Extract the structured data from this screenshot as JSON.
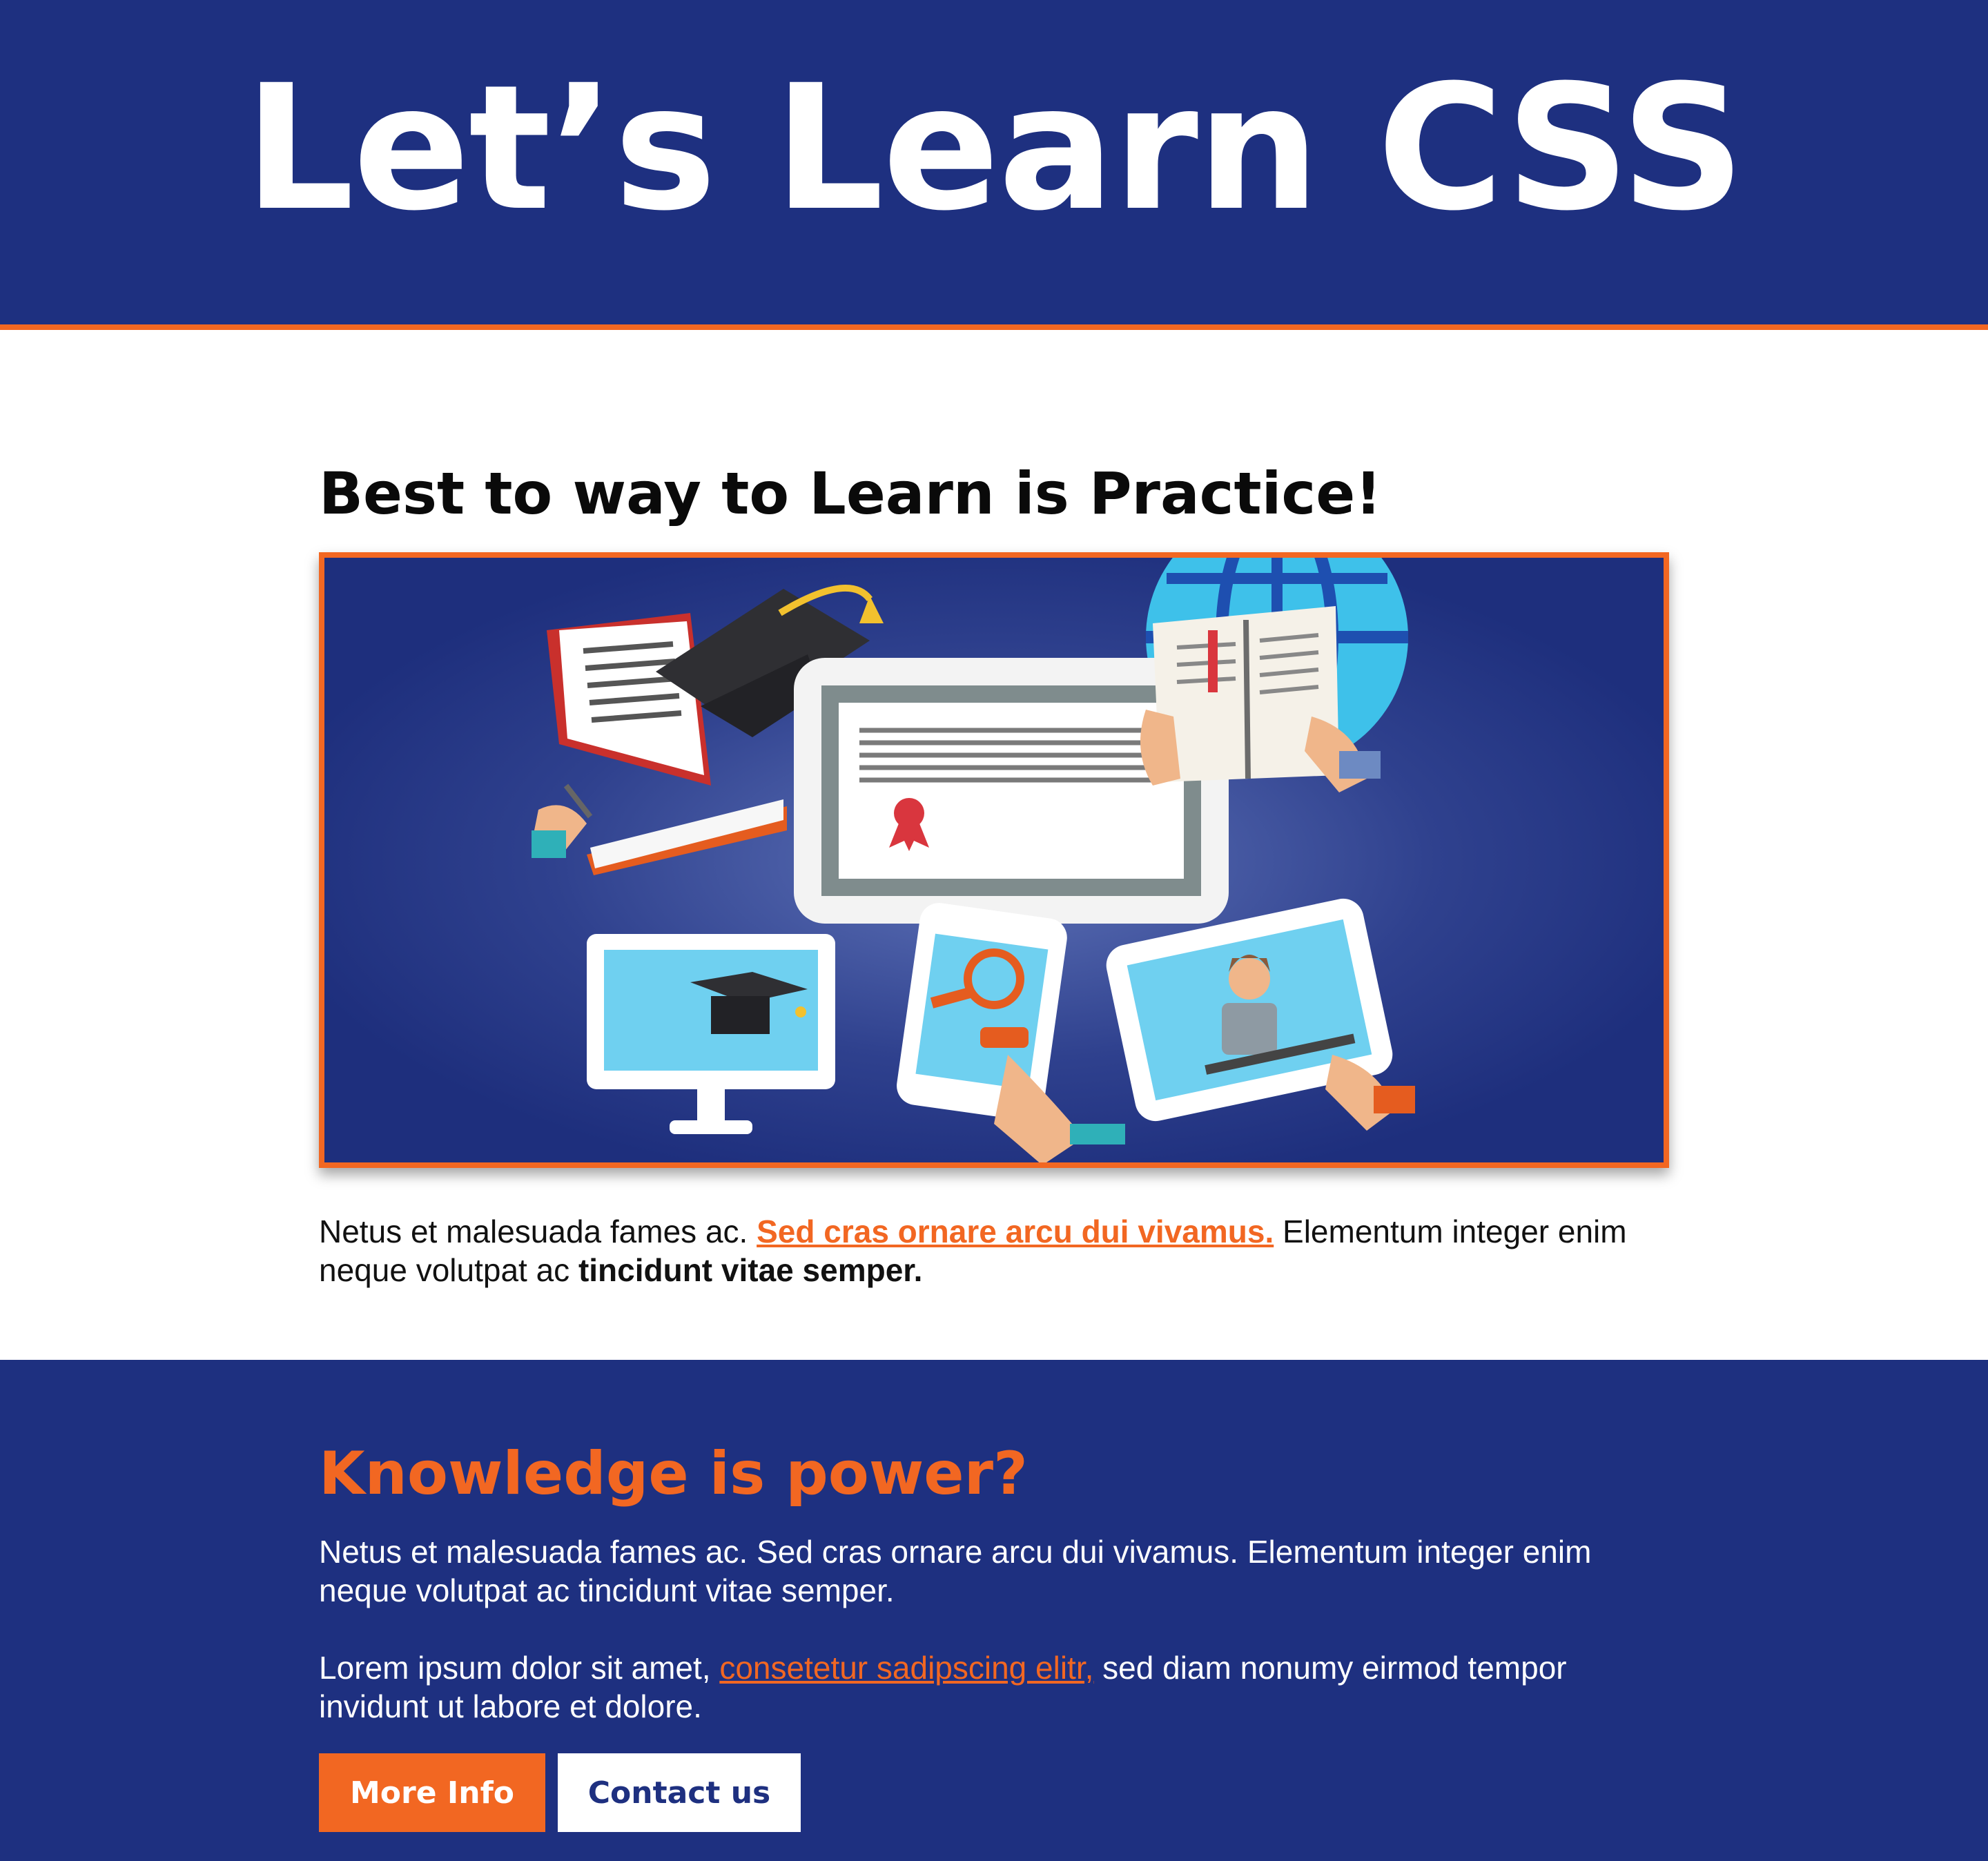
{
  "header": {
    "title": "Let’s Learn CSS"
  },
  "main": {
    "heading": "Best to way to Learn is Practice!",
    "image_alt": "Online learning illustration: books, graduation caps, tablets, phone and video lesson",
    "paragraph": {
      "lead": "Netus et malesuada fames ac. ",
      "link": "Sed cras ornare arcu dui vivamus.",
      "middle": " Elementum integer enim neque volutpat ac ",
      "bold": "tincidunt vitae semper."
    }
  },
  "lower": {
    "heading": "Knowledge is power?",
    "paragraph1": "Netus et malesuada fames ac. Sed cras ornare arcu dui vivamus. Elementum integer enim neque volutpat ac tincidunt vitae semper.",
    "paragraph2": {
      "lead": "Lorem ipsum dolor sit amet, ",
      "link": "consetetur sadipscing elitr,",
      "tail": " sed diam nonumy eirmod tempor invidunt ut labore et dolore."
    },
    "buttons": {
      "primary": "More Info",
      "secondary": "Contact us"
    }
  },
  "colors": {
    "navy": "#1e3080",
    "orange": "#f26722",
    "white": "#ffffff"
  }
}
